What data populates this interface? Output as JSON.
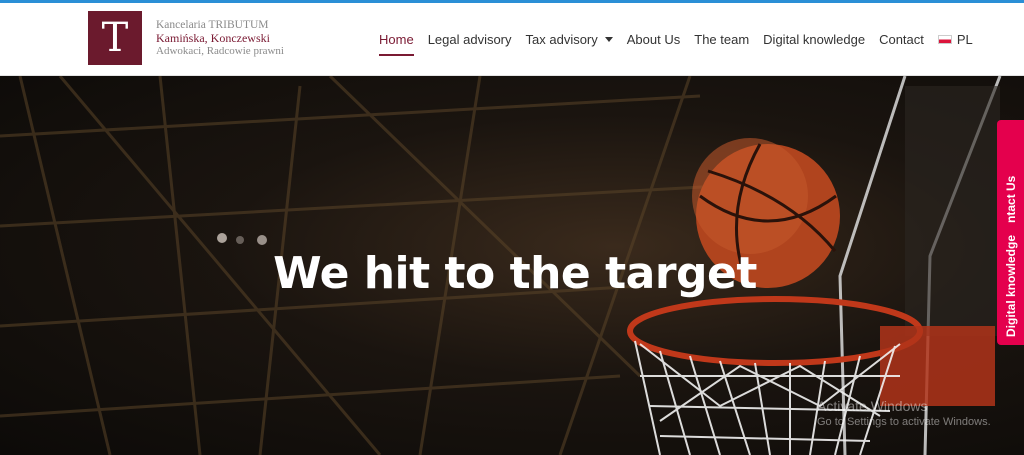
{
  "header": {
    "logo": {
      "mark": "T",
      "line1": "Kancelaria TRIBUTUM",
      "line2": "Kamińska, Konczewski",
      "line3": "Adwokaci, Radcowie prawni"
    },
    "nav": [
      {
        "label": "Home",
        "active": true
      },
      {
        "label": "Legal advisory"
      },
      {
        "label": "Tax advisory",
        "has_dropdown": true
      },
      {
        "label": "About Us"
      },
      {
        "label": "The team"
      },
      {
        "label": "Digital knowledge"
      },
      {
        "label": "Contact"
      }
    ],
    "language": "PL"
  },
  "hero": {
    "title": "We hit to the target"
  },
  "side_tab": {
    "items": [
      "Digital knowledge",
      "ntact Us"
    ]
  },
  "watermark": {
    "line1": "Activate Windows",
    "line2": "Go to Settings to activate Windows."
  },
  "colors": {
    "brand": "#7a1a33",
    "side_tab": "#e4004d"
  }
}
